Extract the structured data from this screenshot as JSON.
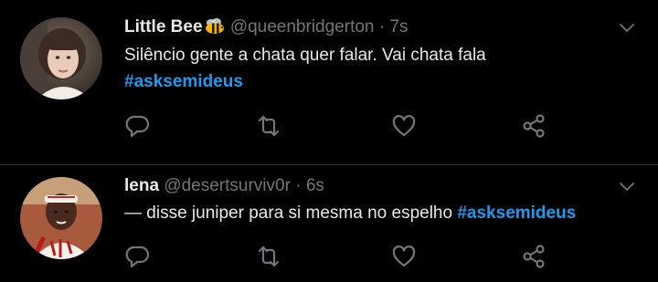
{
  "colors": {
    "background": "#000000",
    "text": "#e7e9ea",
    "secondary": "#71767b",
    "hashtag": "#1d9bf0",
    "divider": "#2f3336"
  },
  "tweets": [
    {
      "name": "Little Bee",
      "name_icon": "bee-emoji-icon",
      "handle": "@queenbridgerton",
      "time": "7s",
      "separator": "·",
      "text": "Silêncio gente a chata quer falar. Vai chata fala",
      "hashtag": "#asksemideus"
    },
    {
      "name": "lena",
      "handle": "@desertsurviv0r",
      "time": "6s",
      "separator": "·",
      "text": "— disse juniper para si mesma no espelho ",
      "hashtag": "#asksemideus"
    }
  ],
  "actions": [
    "reply-icon",
    "retweet-icon",
    "like-icon",
    "share-icon"
  ]
}
